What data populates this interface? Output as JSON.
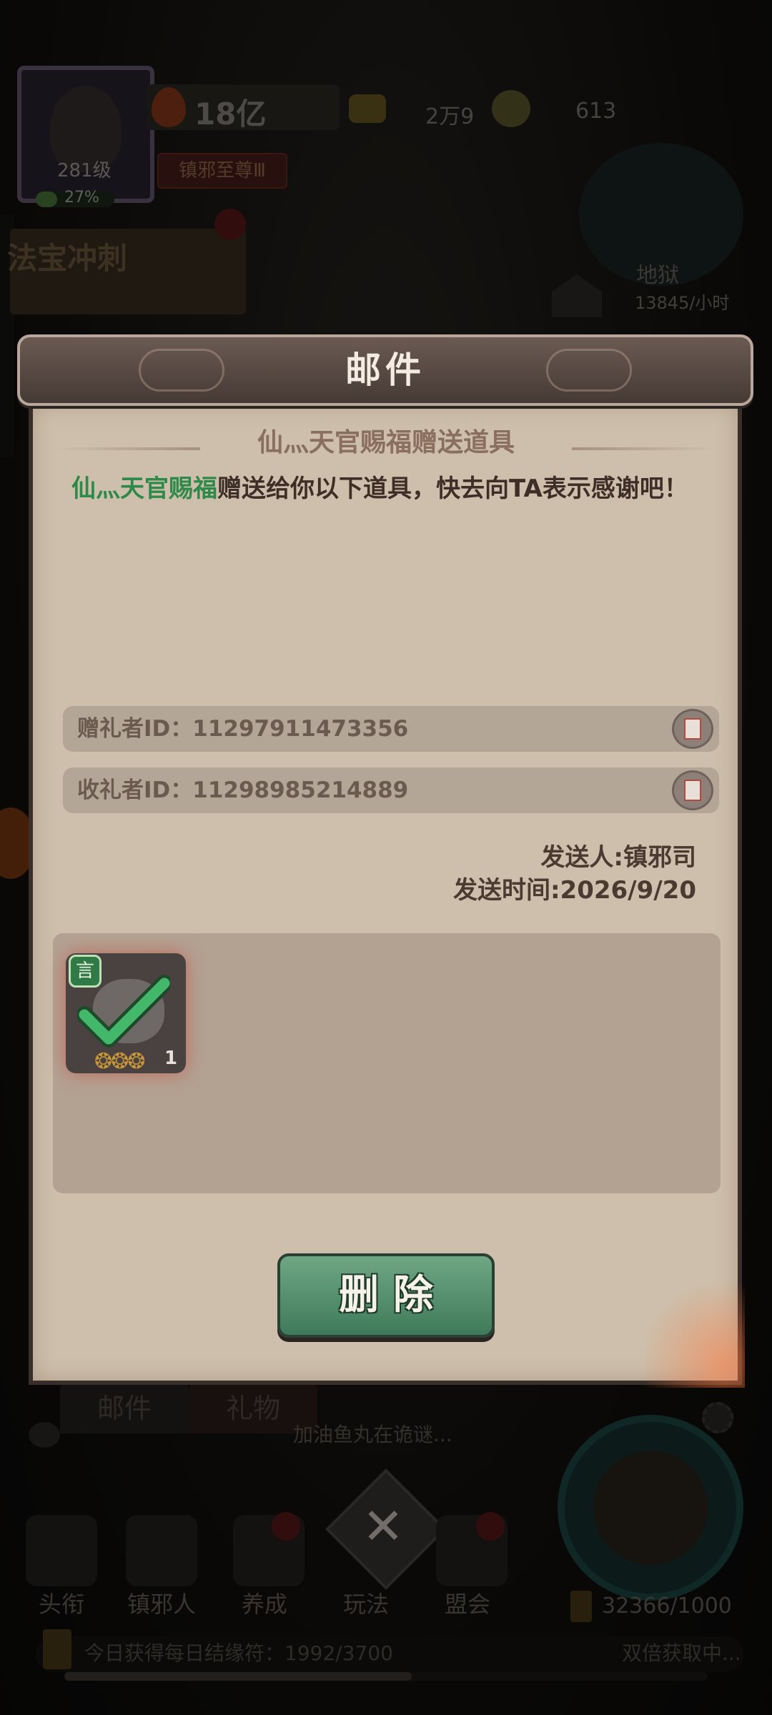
{
  "player": {
    "level_label": "281级",
    "exp_percent_label": "27%",
    "exp_percent": 0.27,
    "power": "18亿",
    "rank_title": "镇邪至尊Ⅲ"
  },
  "currency": {
    "gold": "2万9",
    "gems": "613"
  },
  "event": {
    "title": "法宝冲刺"
  },
  "world": {
    "name": "地狱",
    "rate": "13845/小时"
  },
  "mail": {
    "header_title": "邮件",
    "subject": "仙灬天官赐福赠送道具",
    "sender_highlight": "仙灬天官赐福",
    "body_text": "赠送给你以下道具，快去向TA表示感谢吧！",
    "giver_id_label": "赠礼者ID：11297911473356",
    "receiver_id_label": "收礼者ID：11298985214889",
    "sender_line": "发送人:镇邪司",
    "time_line": "发送时间:2026/9/20",
    "attachment": {
      "grade": "言",
      "count": "1",
      "claimed": true
    },
    "delete_label": "删除"
  },
  "bottom_tabs": {
    "mail": "邮件",
    "gift": "礼物"
  },
  "chat_preview": "加油鱼丸在诡谜...",
  "nav": {
    "items": [
      "头衔",
      "镇邪人",
      "养成",
      "玩法",
      "盟会"
    ]
  },
  "bagua_count": "32366/1000",
  "daily_bar": {
    "text": "今日获得每日结缘符：1992/3700",
    "progress": 0.54,
    "right_text": "双倍获取中..."
  },
  "colors": {
    "sender_green": "#2e8a4a",
    "delete_button": "#4f8e6b",
    "modal_body": "#cdbfab"
  }
}
